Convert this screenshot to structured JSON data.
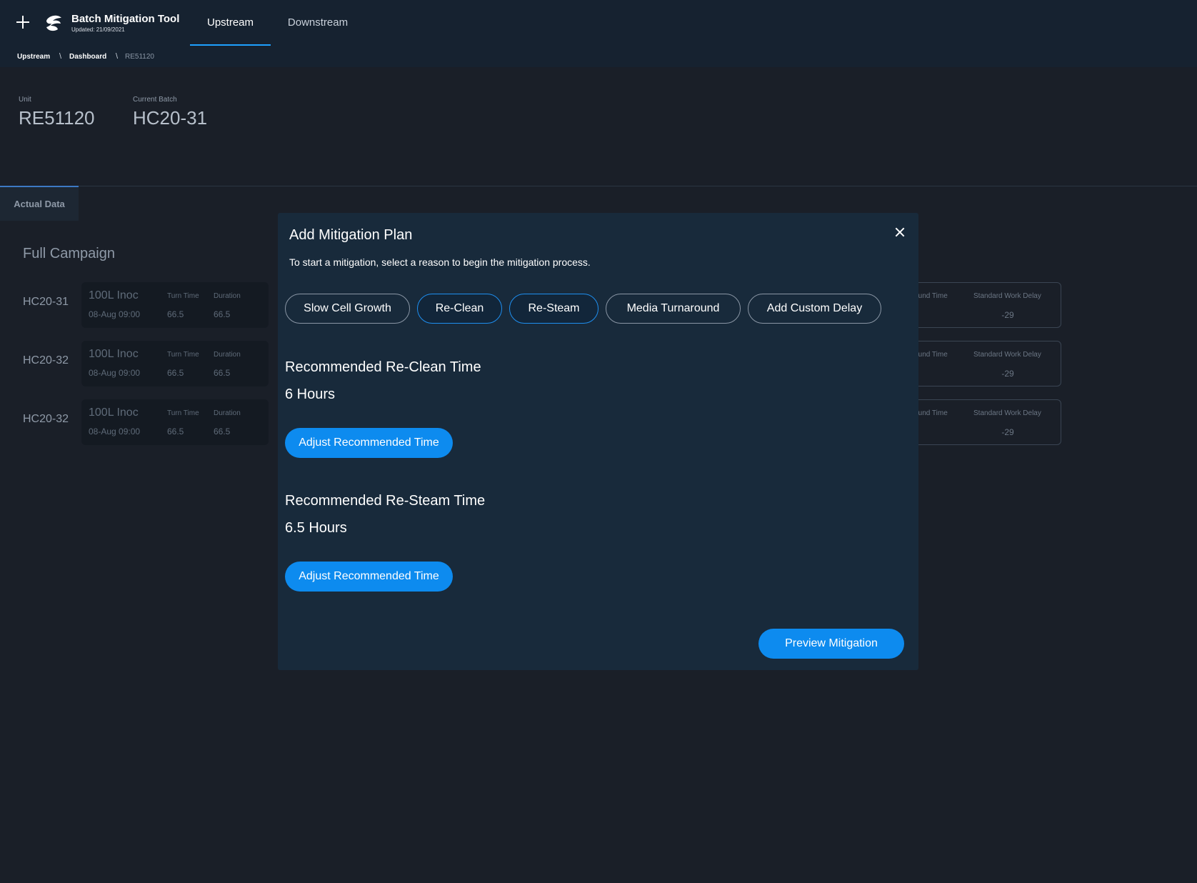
{
  "header": {
    "app_title": "Batch Mitigation Tool",
    "updated": "Updated: 21/09/2021",
    "tabs": [
      {
        "label": "Upstream",
        "active": true
      },
      {
        "label": "Downstream",
        "active": false
      }
    ]
  },
  "breadcrumb": {
    "items": [
      "Upstream",
      "Dashboard",
      "RE51120"
    ],
    "separator": "\\"
  },
  "info": {
    "unit_label": "Unit",
    "unit_value": "RE51120",
    "batch_label": "Current Batch",
    "batch_value": "HC20-31"
  },
  "tabs": {
    "actual_data": "Actual Data"
  },
  "campaign": {
    "title": "Full Campaign",
    "rows": [
      {
        "batch": "HC20-31",
        "step": "100L Inoc",
        "date": "08-Aug 09:00",
        "turn_time_label": "Turn Time",
        "turn_time": "66.5",
        "duration_label": "Duration",
        "duration": "66.5",
        "turnaround_label": "Turnaround Time",
        "delay_label": "Standard Work Delay",
        "delay": "-29"
      },
      {
        "batch": "HC20-32",
        "step": "100L Inoc",
        "date": "08-Aug 09:00",
        "turn_time_label": "Turn Time",
        "turn_time": "66.5",
        "duration_label": "Duration",
        "duration": "66.5",
        "turnaround_label": "Turnaround Time",
        "delay_label": "Standard Work Delay",
        "delay": "-29"
      },
      {
        "batch": "HC20-32",
        "step": "100L Inoc",
        "date": "08-Aug 09:00",
        "turn_time_label": "Turn Time",
        "turn_time": "66.5",
        "duration_label": "Duration",
        "duration": "66.5",
        "turnaround_label": "Turnaround Time",
        "delay_label": "Standard Work Delay",
        "delay": "-29"
      }
    ]
  },
  "modal": {
    "title": "Add Mitigation Plan",
    "description": "To start a mitigation, select a reason to begin the mitigation process.",
    "reasons": [
      {
        "label": "Slow Cell Growth",
        "selected": false
      },
      {
        "label": "Re-Clean",
        "selected": true
      },
      {
        "label": "Re-Steam",
        "selected": true
      },
      {
        "label": "Media Turnaround",
        "selected": false
      },
      {
        "label": "Add Custom Delay",
        "selected": false
      }
    ],
    "recommendations": [
      {
        "title": "Recommended Re-Clean Time",
        "value": "6 Hours",
        "button": "Adjust Recommended Time"
      },
      {
        "title": "Recommended Re-Steam Time",
        "value": "6.5 Hours",
        "button": "Adjust Recommended Time"
      }
    ],
    "preview_button": "Preview Mitigation"
  },
  "colors": {
    "background": "#1a1f28",
    "topbar": "#162230",
    "modal": "#182a3b",
    "accent": "#0d8bef",
    "tab_indicator": "#1ea0ff"
  },
  "icons": [
    "plus-icon",
    "brand-logo-icon",
    "close-icon"
  ]
}
